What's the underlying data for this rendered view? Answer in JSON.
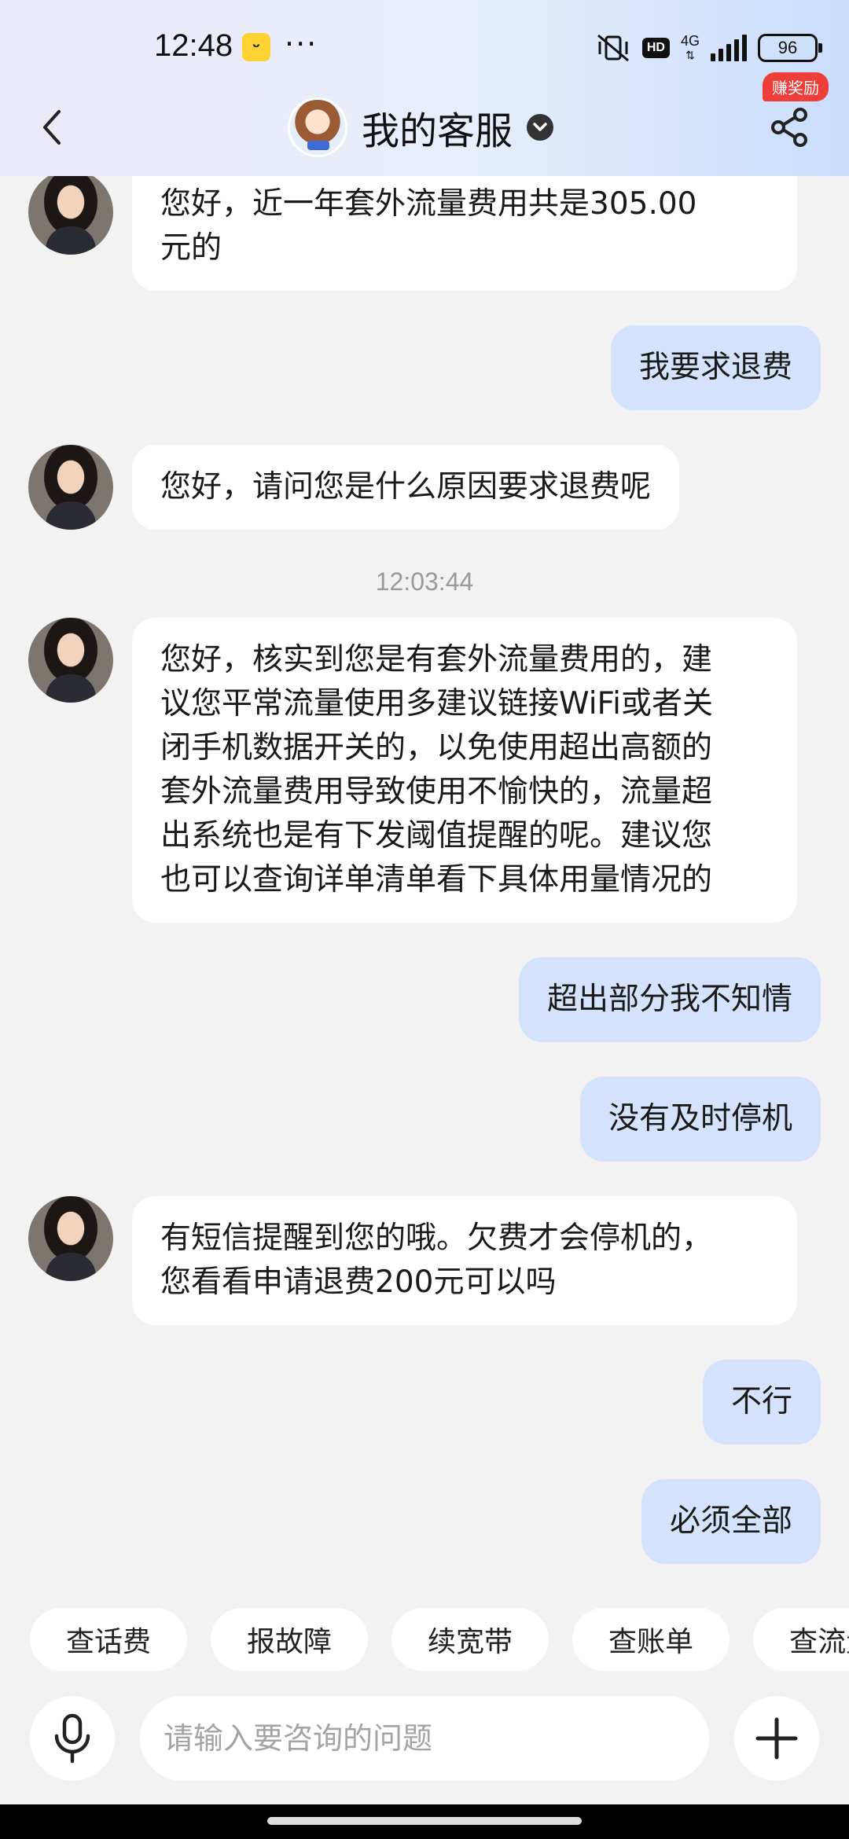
{
  "status_bar": {
    "time": "12:48",
    "dots": "···",
    "hd": "HD",
    "network": "4G",
    "battery": "96"
  },
  "nav": {
    "title": "我的客服",
    "reward_badge": "赚奖励"
  },
  "messages": [
    {
      "from": "agent",
      "text": "您好，近一年套外流量费用共是305.00\n元的"
    },
    {
      "from": "user",
      "text": "我要求退费"
    },
    {
      "from": "agent",
      "text": "您好，请问您是什么原因要求退费呢"
    },
    {
      "from": "timestamp",
      "text": "12:03:44"
    },
    {
      "from": "agent",
      "text": "您好，核实到您是有套外流量费用的，建\n议您平常流量使用多建议链接WiFi或者关\n闭手机数据开关的，以免使用超出高额的\n套外流量费用导致使用不愉快的，流量超\n出系统也是有下发阈值提醒的呢。建议您\n也可以查询详单清单看下具体用量情况的"
    },
    {
      "from": "user",
      "text": "超出部分我不知情"
    },
    {
      "from": "user",
      "text": "没有及时停机"
    },
    {
      "from": "agent",
      "text": "有短信提醒到您的哦。欠费才会停机的，\n您看看申请退费200元可以吗"
    },
    {
      "from": "user",
      "text": "不行"
    },
    {
      "from": "user",
      "text": "必须全部"
    }
  ],
  "quick_replies": [
    "查话费",
    "报故障",
    "续宽带",
    "查账单",
    "查流量"
  ],
  "input": {
    "placeholder": "请输入要咨询的问题"
  },
  "icons": {
    "back": "back-arrow-icon",
    "verified": "chevron-down-icon",
    "share": "share-icon",
    "mic": "microphone-icon",
    "plus": "plus-icon"
  },
  "colors": {
    "user_bubble": "#d5e2fb",
    "agent_bubble": "#ffffff",
    "background": "#f2f2f2",
    "reward_badge": "#ef3d3a"
  }
}
